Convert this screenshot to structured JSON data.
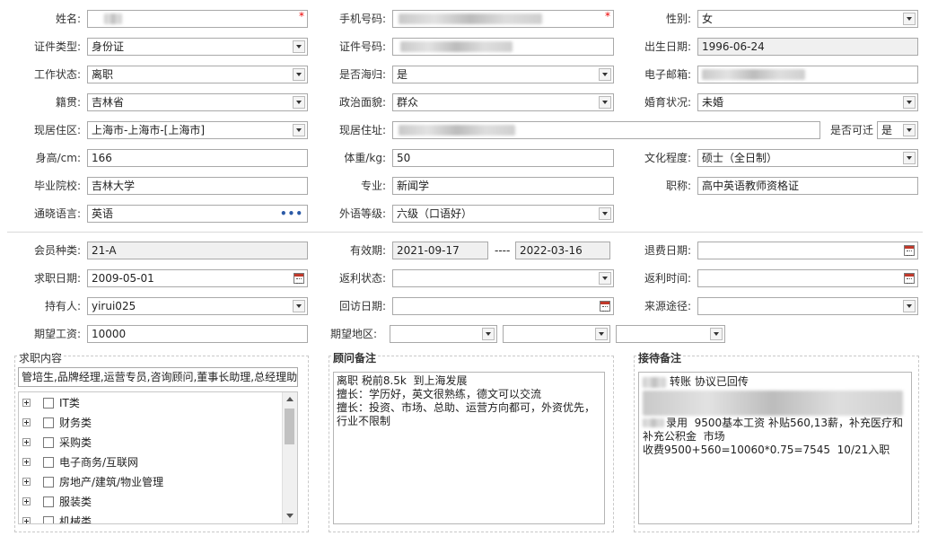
{
  "basic": {
    "name_label": "姓名:",
    "phone_label": "手机号码:",
    "gender_label": "性别:",
    "gender_value": "女",
    "id_type_label": "证件类型:",
    "id_type_value": "身份证",
    "id_no_label": "证件号码:",
    "birth_label": "出生日期:",
    "birth_value": "1996-06-24",
    "work_status_label": "工作状态:",
    "work_status_value": "离职",
    "returnee_label": "是否海归:",
    "returnee_value": "是",
    "email_label": "电子邮箱:",
    "native_label": "籍贯:",
    "native_value": "吉林省",
    "political_label": "政治面貌:",
    "political_value": "群众",
    "marital_label": "婚育状况:",
    "marital_value": "未婚",
    "residence_label": "现居住区:",
    "residence_value": "上海市-上海市-[上海市]",
    "address_label": "现居住址:",
    "relocate_label": "是否可迁",
    "relocate_value": "是",
    "height_label": "身高/cm:",
    "height_value": "166",
    "weight_label": "体重/kg:",
    "weight_value": "50",
    "education_label": "文化程度:",
    "education_value": "硕士（全日制）",
    "school_label": "毕业院校:",
    "school_value": "吉林大学",
    "major_label": "专业:",
    "major_value": "新闻学",
    "title_label": "职称:",
    "title_value": "高中英语教师资格证",
    "language_label": "通晓语言:",
    "language_value": "英语",
    "language_more": "•••",
    "lang_level_label": "外语等级:",
    "lang_level_value": "六级（口语好）"
  },
  "membership": {
    "type_label": "会员种类:",
    "type_value": "21-A",
    "valid_label": "有效期:",
    "valid_from": "2021-09-17",
    "valid_sep": "----",
    "valid_to": "2022-03-16",
    "refund_label": "退费日期:",
    "job_date_label": "求职日期:",
    "job_date_value": "2009-05-01",
    "rebate_status_label": "返利状态:",
    "rebate_time_label": "返利时间:",
    "holder_label": "持有人:",
    "holder_value": "yirui025",
    "visit_date_label": "回访日期:",
    "source_label": "来源途径:",
    "salary_label": "期望工资:",
    "salary_value": "10000",
    "region_label": "期望地区:"
  },
  "job_content": {
    "title": "求职内容",
    "summary": "管培生,品牌经理,运营专员,咨询顾问,董事长助理,总经理助",
    "tree": [
      {
        "label": "IT类"
      },
      {
        "label": "财务类"
      },
      {
        "label": "采购类"
      },
      {
        "label": "电子商务/互联网"
      },
      {
        "label": "房地产/建筑/物业管理"
      },
      {
        "label": "服装类"
      },
      {
        "label": "机械类"
      }
    ]
  },
  "consultant_note": {
    "title": "顾问备注",
    "text": "离职 税前8.5k  到上海发展\n擅长：学历好，英文很熟练，德文可以交流\n擅长：投资、市场、总助、运营方向都可，外资优先，行业不限制"
  },
  "reception_note": {
    "title": "接待备注",
    "line1": "转账 协议已回传",
    "line2": "录用  9500基本工资 补贴560,13薪，补充医疗和补充公积金  市场",
    "line3": "收费9500+560=10060*0.75=7545  10/21入职"
  },
  "colors": {
    "required": "#ee0000",
    "readonly_bg": "#f0f0f0",
    "border": "#a9a9a9"
  }
}
